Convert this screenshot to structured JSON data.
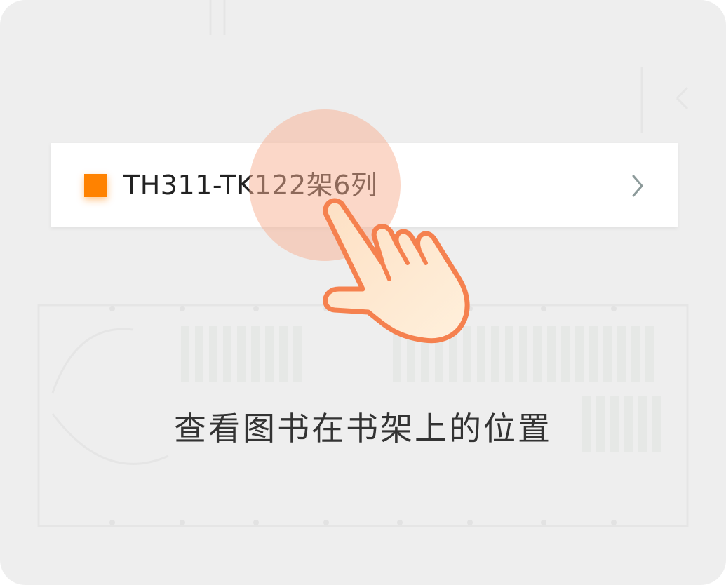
{
  "location_item": {
    "label": "TH311-TK122架6列",
    "marker_color": "#ff8200",
    "chevron_icon": "chevron-right-icon"
  },
  "tap_indicator": {
    "icon": "pointing-hand-icon",
    "circle_color": "#f8af91"
  },
  "caption": "查看图书在书架上的位置",
  "colors": {
    "background": "#eeeeee",
    "row_background": "#ffffff",
    "text": "#222222"
  }
}
